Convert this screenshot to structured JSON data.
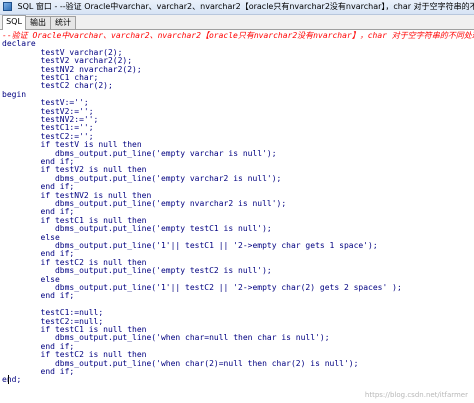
{
  "window": {
    "title": "SQL 窗口 - --验证 Oracle中varchar、varchar2、nvarchar2【oracle只有nvarchar2没有nvarchar】，char 对于空字符串的不同处理 declare tes ..."
  },
  "tabs": [
    {
      "label": "SQL",
      "active": true
    },
    {
      "label": "输出",
      "active": false
    },
    {
      "label": "统计",
      "active": false
    }
  ],
  "code": [
    {
      "text": "--验证 Oracle中varchar、varchar2、nvarchar2【oracle只有nvarchar2没有nvarchar】，char 对于空字符串的不同处理;",
      "type": "comment"
    },
    {
      "text": "declare",
      "type": "kw"
    },
    {
      "text": "        testV varchar(2);",
      "type": "kw"
    },
    {
      "text": "        testV2 varchar2(2);",
      "type": "kw"
    },
    {
      "text": "        testNV2 nvarchar2(2);",
      "type": "kw"
    },
    {
      "text": "        testC1 char;",
      "type": "kw"
    },
    {
      "text": "        testC2 char(2);",
      "type": "kw"
    },
    {
      "text": "begin",
      "type": "kw"
    },
    {
      "text": "        testV:='';",
      "type": "kw"
    },
    {
      "text": "        testV2:='';",
      "type": "kw"
    },
    {
      "text": "        testNV2:='';",
      "type": "kw"
    },
    {
      "text": "        testC1:='';",
      "type": "kw"
    },
    {
      "text": "        testC2:='';",
      "type": "kw"
    },
    {
      "text": "        if testV is null then",
      "type": "kw"
    },
    {
      "text": "           dbms_output.put_line('empty varchar is null');",
      "type": "kw"
    },
    {
      "text": "        end if;",
      "type": "kw"
    },
    {
      "text": "        if testV2 is null then",
      "type": "kw"
    },
    {
      "text": "           dbms_output.put_line('empty varchar2 is null');",
      "type": "kw"
    },
    {
      "text": "        end if;",
      "type": "kw"
    },
    {
      "text": "        if testNV2 is null then",
      "type": "kw"
    },
    {
      "text": "           dbms_output.put_line('empty nvarchar2 is null');",
      "type": "kw"
    },
    {
      "text": "        end if;",
      "type": "kw"
    },
    {
      "text": "        if testC1 is null then",
      "type": "kw"
    },
    {
      "text": "           dbms_output.put_line('empty testC1 is null');",
      "type": "kw"
    },
    {
      "text": "        else",
      "type": "kw"
    },
    {
      "text": "           dbms_output.put_line('1'|| testC1 || '2->empty char gets 1 space');",
      "type": "kw"
    },
    {
      "text": "        end if;",
      "type": "kw"
    },
    {
      "text": "        if testC2 is null then",
      "type": "kw"
    },
    {
      "text": "           dbms_output.put_line('empty testC2 is null');",
      "type": "kw"
    },
    {
      "text": "        else",
      "type": "kw"
    },
    {
      "text": "           dbms_output.put_line('1'|| testC2 || '2->empty char(2) gets 2 spaces' );",
      "type": "kw"
    },
    {
      "text": "        end if;",
      "type": "kw"
    },
    {
      "text": "",
      "type": "kw"
    },
    {
      "text": "        testC1:=null;",
      "type": "kw"
    },
    {
      "text": "        testC2:=null;",
      "type": "kw"
    },
    {
      "text": "        if testC1 is null then",
      "type": "kw"
    },
    {
      "text": "           dbms_output.put_line('when char=null then char is null');",
      "type": "kw"
    },
    {
      "text": "        end if;",
      "type": "kw"
    },
    {
      "text": "        if testC2 is null then",
      "type": "kw"
    },
    {
      "text": "           dbms_output.put_line('when char(2)=null then char(2) is null');",
      "type": "kw"
    },
    {
      "text": "        end if;",
      "type": "kw"
    },
    {
      "text": "end;",
      "type": "kw"
    }
  ],
  "watermark": "https://blog.csdn.net/itfarmer"
}
